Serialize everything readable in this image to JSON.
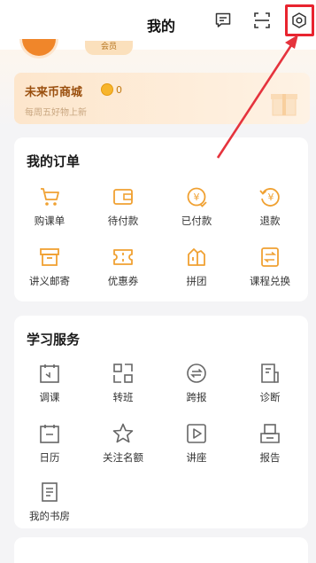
{
  "header": {
    "title": "我的",
    "icons": [
      "message-icon",
      "scan-icon",
      "settings-icon"
    ],
    "vip_label": "会员"
  },
  "mall": {
    "title": "未来币商城",
    "coins": "0",
    "subtitle": "每周五好物上新"
  },
  "orders": {
    "title": "我的订单",
    "items": [
      {
        "label": "购课单",
        "icon": "cart-icon"
      },
      {
        "label": "待付款",
        "icon": "wallet-icon"
      },
      {
        "label": "已付款",
        "icon": "paid-coin-icon"
      },
      {
        "label": "退款",
        "icon": "refund-icon"
      },
      {
        "label": "讲义邮寄",
        "icon": "box-icon"
      },
      {
        "label": "优惠券",
        "icon": "coupon-icon"
      },
      {
        "label": "拼团",
        "icon": "group-buy-icon"
      },
      {
        "label": "课程兑换",
        "icon": "exchange-icon"
      }
    ]
  },
  "services": {
    "title": "学习服务",
    "items": [
      {
        "label": "调课",
        "icon": "calendar-adjust-icon"
      },
      {
        "label": "转班",
        "icon": "grid-swap-icon"
      },
      {
        "label": "跨报",
        "icon": "cross-register-icon"
      },
      {
        "label": "诊断",
        "icon": "diagnosis-doc-icon"
      },
      {
        "label": "日历",
        "icon": "calendar-icon"
      },
      {
        "label": "关注名额",
        "icon": "star-icon"
      },
      {
        "label": "讲座",
        "icon": "play-icon"
      },
      {
        "label": "报告",
        "icon": "report-icon"
      },
      {
        "label": "我的书房",
        "icon": "bookshelf-icon"
      }
    ]
  },
  "colors": {
    "accent": "#f0a132",
    "highlight": "#e8242f",
    "mall_title": "#9a4f0e"
  }
}
